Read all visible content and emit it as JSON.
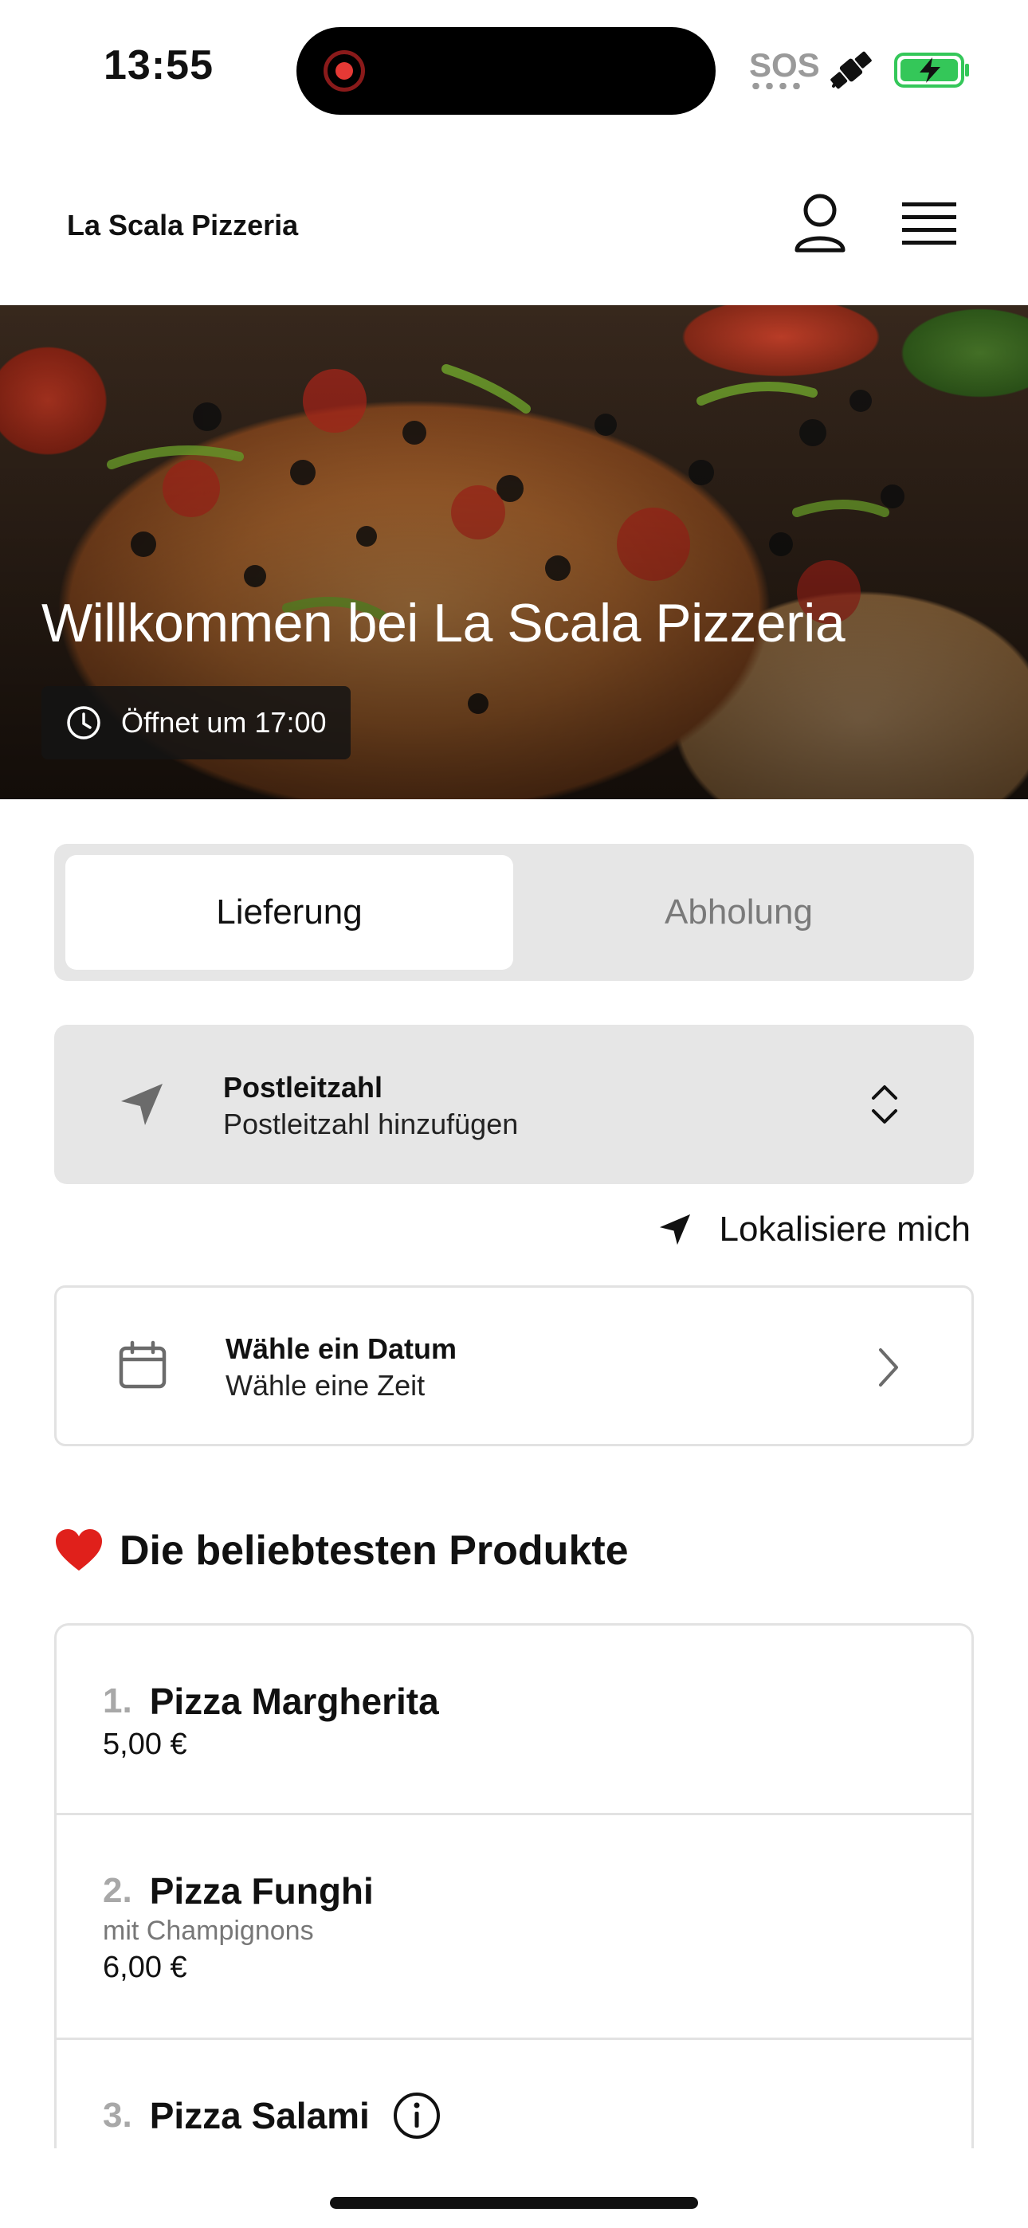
{
  "status_bar": {
    "time": "13:55",
    "sos": "SOS",
    "icons": [
      "screen-recording-icon",
      "satellite-icon",
      "battery-charging-icon"
    ],
    "battery_color": "#34c759"
  },
  "header": {
    "brand": "La Scala Pizzeria",
    "icons": [
      "user-icon",
      "menu-icon"
    ]
  },
  "hero": {
    "title": "Willkommen bei La Scala Pizzeria",
    "opening_badge": "Öffnet um 17:00",
    "badge_icon": "clock-icon"
  },
  "order_mode": {
    "options": [
      "Lieferung",
      "Abholung"
    ],
    "selected": "Lieferung"
  },
  "postal_code": {
    "title": "Postleitzahl",
    "placeholder": "Postleitzahl hinzufügen",
    "icon": "location-arrow-icon"
  },
  "locate_me": {
    "label": "Lokalisiere mich",
    "icon": "location-arrow-icon"
  },
  "date_picker": {
    "title": "Wähle ein Datum",
    "subtitle": "Wähle eine Zeit",
    "icon": "calendar-icon"
  },
  "popular": {
    "title": "Die beliebtesten Produkte",
    "icon": "heart-icon",
    "items": [
      {
        "rank": "1.",
        "name": "Pizza Margherita",
        "description": "",
        "price": "5,00 €"
      },
      {
        "rank": "2.",
        "name": "Pizza Funghi",
        "description": "mit Champignons",
        "price": "6,00 €"
      },
      {
        "rank": "3.",
        "name": "Pizza Salami",
        "description": "",
        "price": ""
      }
    ]
  }
}
